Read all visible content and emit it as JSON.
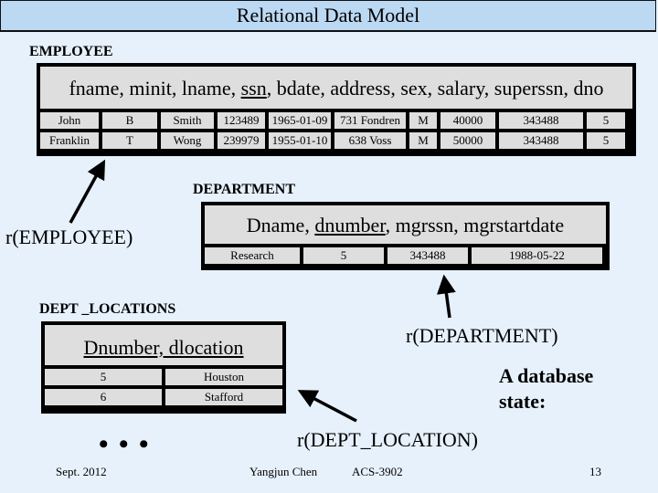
{
  "slide": {
    "title": "Relational Data Model",
    "background_color": "#e6f1fc",
    "title_bar_color": "#bcd9f4",
    "cell_color": "#dedede"
  },
  "employee": {
    "relation_name": "EMPLOYEE",
    "schema_parts": [
      {
        "text": "fname, minit, lname, ",
        "key": false
      },
      {
        "text": "ssn",
        "key": true
      },
      {
        "text": ", bdate, address, sex, salary, superssn, dno",
        "key": false
      }
    ],
    "rows": [
      [
        "John",
        "B",
        "Smith",
        "123489",
        "1965-01-09",
        "731 Fondren",
        "M",
        "40000",
        "343488",
        "5"
      ],
      [
        "Franklin",
        "T",
        "Wong",
        "239979",
        "1955-01-10",
        "638 Voss",
        "M",
        "50000",
        "343488",
        "5"
      ]
    ],
    "state_label": "r(EMPLOYEE)"
  },
  "department": {
    "relation_name": "DEPARTMENT",
    "schema_parts": [
      {
        "text": "Dname, ",
        "key": false
      },
      {
        "text": "dnumber",
        "key": true
      },
      {
        "text": ", mgrssn, mgrstartdate",
        "key": false
      }
    ],
    "rows": [
      [
        "Research",
        "5",
        "343488",
        "1988-05-22"
      ]
    ],
    "state_label": "r(DEPARTMENT)"
  },
  "dept_locations": {
    "relation_name": "DEPT _LOCATIONS",
    "schema": "Dnumber, dlocation",
    "rows": [
      [
        "5",
        "Houston"
      ],
      [
        "6",
        "Stafford"
      ]
    ],
    "state_label": "r(DEPT_LOCATION)",
    "ellipsis": "• • •"
  },
  "note": {
    "line1": "A database",
    "line2": "state:"
  },
  "footer": {
    "date": "Sept. 2012",
    "author": "Yangjun Chen",
    "course": "ACS-3902",
    "page": "13"
  }
}
